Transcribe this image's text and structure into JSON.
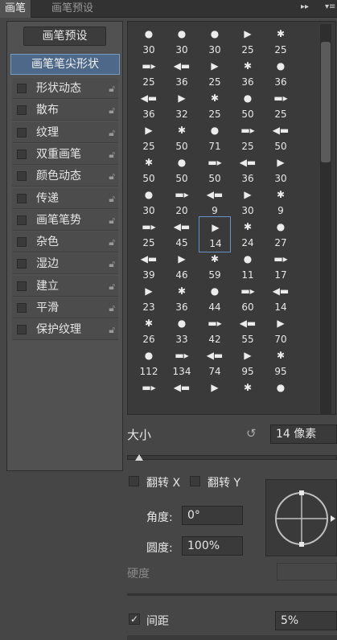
{
  "tabs": [
    {
      "label": "画笔"
    },
    {
      "label": "画笔预设"
    }
  ],
  "toolbar_icons": [
    "expand-icon",
    "panel-menu-icon"
  ],
  "left_panel": {
    "preset_button": "画笔预设",
    "tip_shape_label": "画笔笔尖形状",
    "options": [
      {
        "label": "形状动态"
      },
      {
        "label": "散布"
      },
      {
        "label": "纹理"
      },
      {
        "label": "双重画笔"
      },
      {
        "label": "颜色动态"
      },
      {
        "label": "传递"
      },
      {
        "label": "画笔笔势"
      },
      {
        "label": "杂色"
      },
      {
        "label": "湿边"
      },
      {
        "label": "建立"
      },
      {
        "label": "平滑"
      },
      {
        "label": "保护纹理"
      }
    ]
  },
  "brush_grid": {
    "rows": [
      [
        "30",
        "30",
        "30",
        "25",
        "25"
      ],
      [
        "25",
        "36",
        "25",
        "36",
        "36"
      ],
      [
        "36",
        "32",
        "25",
        "50",
        "25"
      ],
      [
        "25",
        "50",
        "71",
        "25",
        "50"
      ],
      [
        "50",
        "50",
        "50",
        "36",
        "30"
      ],
      [
        "30",
        "20",
        "9",
        "30",
        "9"
      ],
      [
        "25",
        "45",
        "14",
        "24",
        "27"
      ],
      [
        "39",
        "46",
        "59",
        "11",
        "17"
      ],
      [
        "23",
        "36",
        "44",
        "60",
        "14"
      ],
      [
        "26",
        "33",
        "42",
        "55",
        "70"
      ],
      [
        "112",
        "134",
        "74",
        "95",
        "95"
      ],
      [
        "",
        "",
        "",
        "",
        ""
      ]
    ],
    "selected": "14"
  },
  "size": {
    "label": "大小",
    "value": "14 像素"
  },
  "flip_x": {
    "label": "翻转 X"
  },
  "flip_y": {
    "label": "翻转 Y"
  },
  "angle": {
    "label": "角度:",
    "value": "0°"
  },
  "roundness": {
    "label": "圆度:",
    "value": "100%"
  },
  "hardness": {
    "label": "硬度"
  },
  "spacing": {
    "label": "间距",
    "value": "5%",
    "checked": true
  }
}
